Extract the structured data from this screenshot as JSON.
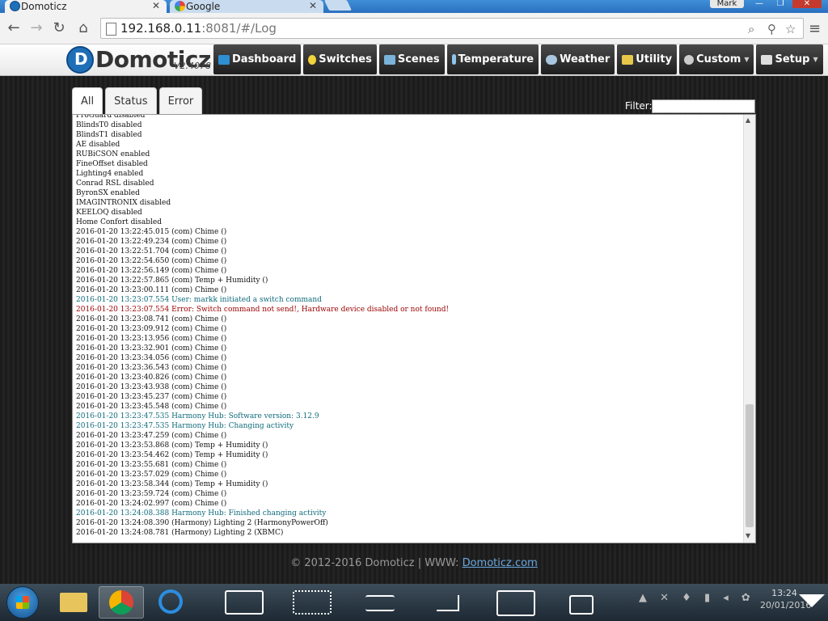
{
  "browser": {
    "tabs": [
      {
        "label": "Domoticz",
        "active": true
      },
      {
        "label": "Google",
        "active": false
      }
    ],
    "user": "Mark",
    "url_host": "192.168.0.11",
    "url_rest": ":8081/#/Log"
  },
  "app": {
    "brand": "Domoticz",
    "version": "V2.4078",
    "nav": [
      {
        "label": "Dashboard",
        "color": "#2e8fd4",
        "dropdown": false
      },
      {
        "label": "Switches",
        "color": "#f2d33b",
        "dropdown": false
      },
      {
        "label": "Scenes",
        "color": "#7ab3d9",
        "dropdown": false
      },
      {
        "label": "Temperature",
        "color": "#8fc4ea",
        "dropdown": false
      },
      {
        "label": "Weather",
        "color": "#a9c6de",
        "dropdown": false
      },
      {
        "label": "Utility",
        "color": "#e6c94a",
        "dropdown": false
      },
      {
        "label": "Custom",
        "color": "#cccccc",
        "dropdown": true
      },
      {
        "label": "Setup",
        "color": "#dddddd",
        "dropdown": true
      }
    ]
  },
  "log": {
    "tabs": [
      {
        "label": "All",
        "active": true
      },
      {
        "label": "Status",
        "active": false
      },
      {
        "label": "Error",
        "active": false
      }
    ],
    "filter_label": "Filter:",
    "filter_value": "",
    "lines": [
      {
        "text": "ProGuard disabled",
        "kind": "normal"
      },
      {
        "text": "BlindsT0 disabled",
        "kind": "normal"
      },
      {
        "text": "BlindsT1 disabled",
        "kind": "normal"
      },
      {
        "text": "AE disabled",
        "kind": "normal"
      },
      {
        "text": "RUBiCSON enabled",
        "kind": "normal"
      },
      {
        "text": "FineOffset disabled",
        "kind": "normal"
      },
      {
        "text": "Lighting4 enabled",
        "kind": "normal"
      },
      {
        "text": "Conrad RSL disabled",
        "kind": "normal"
      },
      {
        "text": "ByronSX enabled",
        "kind": "normal"
      },
      {
        "text": "IMAGINTRONIX disabled",
        "kind": "normal"
      },
      {
        "text": "KEELOQ disabled",
        "kind": "normal"
      },
      {
        "text": "Home Confort disabled",
        "kind": "normal"
      },
      {
        "text": "2016-01-20 13:22:45.015 (com) Chime ()",
        "kind": "normal"
      },
      {
        "text": "2016-01-20 13:22:49.234 (com) Chime ()",
        "kind": "normal"
      },
      {
        "text": "2016-01-20 13:22:51.704 (com) Chime ()",
        "kind": "normal"
      },
      {
        "text": "2016-01-20 13:22:54.650 (com) Chime ()",
        "kind": "normal"
      },
      {
        "text": "2016-01-20 13:22:56.149 (com) Chime ()",
        "kind": "normal"
      },
      {
        "text": "2016-01-20 13:22:57.865 (com) Temp + Humidity ()",
        "kind": "normal"
      },
      {
        "text": "2016-01-20 13:23:00.111 (com) Chime ()",
        "kind": "normal"
      },
      {
        "text": "2016-01-20 13:23:07.554 User: markk initiated a switch command",
        "kind": "status"
      },
      {
        "text": "2016-01-20 13:23:07.554 Error: Switch command not send!, Hardware device disabled or not found!",
        "kind": "error"
      },
      {
        "text": "2016-01-20 13:23:08.741 (com) Chime ()",
        "kind": "normal"
      },
      {
        "text": "2016-01-20 13:23:09.912 (com) Chime ()",
        "kind": "normal"
      },
      {
        "text": "2016-01-20 13:23:13.956 (com) Chime ()",
        "kind": "normal"
      },
      {
        "text": "2016-01-20 13:23:32.901 (com) Chime ()",
        "kind": "normal"
      },
      {
        "text": "2016-01-20 13:23:34.056 (com) Chime ()",
        "kind": "normal"
      },
      {
        "text": "2016-01-20 13:23:36.543 (com) Chime ()",
        "kind": "normal"
      },
      {
        "text": "2016-01-20 13:23:40.826 (com) Chime ()",
        "kind": "normal"
      },
      {
        "text": "2016-01-20 13:23:43.938 (com) Chime ()",
        "kind": "normal"
      },
      {
        "text": "2016-01-20 13:23:45.237 (com) Chime ()",
        "kind": "normal"
      },
      {
        "text": "2016-01-20 13:23:45.548 (com) Chime ()",
        "kind": "normal"
      },
      {
        "text": "2016-01-20 13:23:47.535 Harmony Hub: Software version: 3.12.9",
        "kind": "status"
      },
      {
        "text": "2016-01-20 13:23:47.535 Harmony Hub: Changing activity",
        "kind": "status"
      },
      {
        "text": "2016-01-20 13:23:47.259 (com) Chime ()",
        "kind": "normal"
      },
      {
        "text": "2016-01-20 13:23:53.868 (com) Temp + Humidity ()",
        "kind": "normal"
      },
      {
        "text": "2016-01-20 13:23:54.462 (com) Temp + Humidity ()",
        "kind": "normal"
      },
      {
        "text": "2016-01-20 13:23:55.681 (com) Chime ()",
        "kind": "normal"
      },
      {
        "text": "2016-01-20 13:23:57.029 (com) Chime ()",
        "kind": "normal"
      },
      {
        "text": "2016-01-20 13:23:58.344 (com) Temp + Humidity ()",
        "kind": "normal"
      },
      {
        "text": "2016-01-20 13:23:59.724 (com) Chime ()",
        "kind": "normal"
      },
      {
        "text": "2016-01-20 13:24:02.997 (com) Chime ()",
        "kind": "normal"
      },
      {
        "text": "2016-01-20 13:24:08.388 Harmony Hub: Finished changing activity",
        "kind": "status"
      },
      {
        "text": "2016-01-20 13:24:08.390 (Harmony) Lighting 2 (HarmonyPowerOff)",
        "kind": "normal"
      },
      {
        "text": "2016-01-20 13:24:08.781 (Harmony) Lighting 2 (XBMC)",
        "kind": "normal"
      }
    ]
  },
  "footer": {
    "text": "© 2012-2016 Domoticz | WWW: ",
    "link": "Domoticz.com"
  },
  "taskbar": {
    "time": "13:24",
    "date": "20/01/2016"
  }
}
